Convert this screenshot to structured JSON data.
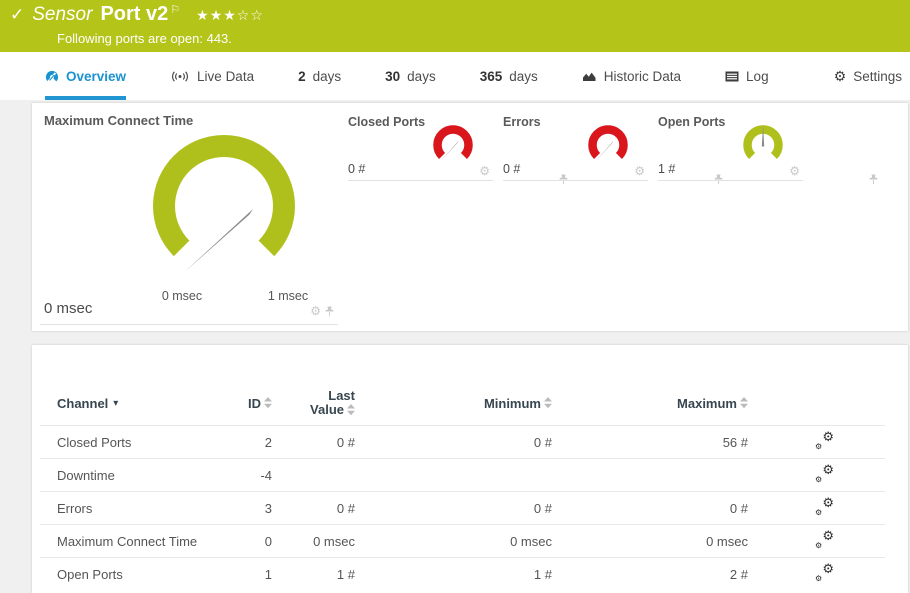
{
  "banner": {
    "bg_color": "#b5c419",
    "check_icon": "✓",
    "kind_label": "Sensor",
    "sensor_name": "Port v2",
    "flag_icon": "⚐",
    "stars_filled": "★★★",
    "stars_empty": "☆☆",
    "message": "Following ports are open: 443."
  },
  "tabs": {
    "active_color": "#1a93d0",
    "overview": {
      "label": "Overview"
    },
    "live_data": {
      "label": "Live Data"
    },
    "days2": {
      "bold": "2",
      "label": "days"
    },
    "days30": {
      "bold": "30",
      "label": "days"
    },
    "days365": {
      "bold": "365",
      "label": "days"
    },
    "historic": {
      "label": "Historic Data"
    },
    "log": {
      "label": "Log"
    },
    "settings": {
      "label": "Settings"
    },
    "gear_glyph": "⚙"
  },
  "gauges": {
    "green_color": "#afc01d",
    "red_color": "#d8161c",
    "main": {
      "title": "Maximum Connect Time",
      "value": "0 msec",
      "scale_min_label": "0 msec",
      "scale_max_label": "1 msec"
    },
    "mini": [
      {
        "title": "Closed Ports",
        "value": "0 #",
        "color": "#d8161c"
      },
      {
        "title": "Errors",
        "value": "0 #",
        "color": "#d8161c"
      },
      {
        "title": "Open Ports",
        "value": "1 #",
        "color": "#afc01d"
      }
    ],
    "gear_glyph": "⚙"
  },
  "table": {
    "headers": {
      "channel": "Channel",
      "channel_caret": "▾",
      "id": "ID",
      "last_line1": "Last",
      "last_line2": "Value",
      "minimum": "Minimum",
      "maximum": "Maximum"
    },
    "gear_glyph": "⚙",
    "rows": [
      {
        "channel": "Closed Ports",
        "id": "2",
        "last": "0 #",
        "min": "0 #",
        "max": "56 #"
      },
      {
        "channel": "Downtime",
        "id": "-4",
        "last": "",
        "min": "",
        "max": ""
      },
      {
        "channel": "Errors",
        "id": "3",
        "last": "0 #",
        "min": "0 #",
        "max": "0 #"
      },
      {
        "channel": "Maximum Connect Time",
        "id": "0",
        "last": "0 msec",
        "min": "0 msec",
        "max": "0 msec"
      },
      {
        "channel": "Open Ports",
        "id": "1",
        "last": "1 #",
        "min": "1 #",
        "max": "2 #"
      }
    ]
  }
}
